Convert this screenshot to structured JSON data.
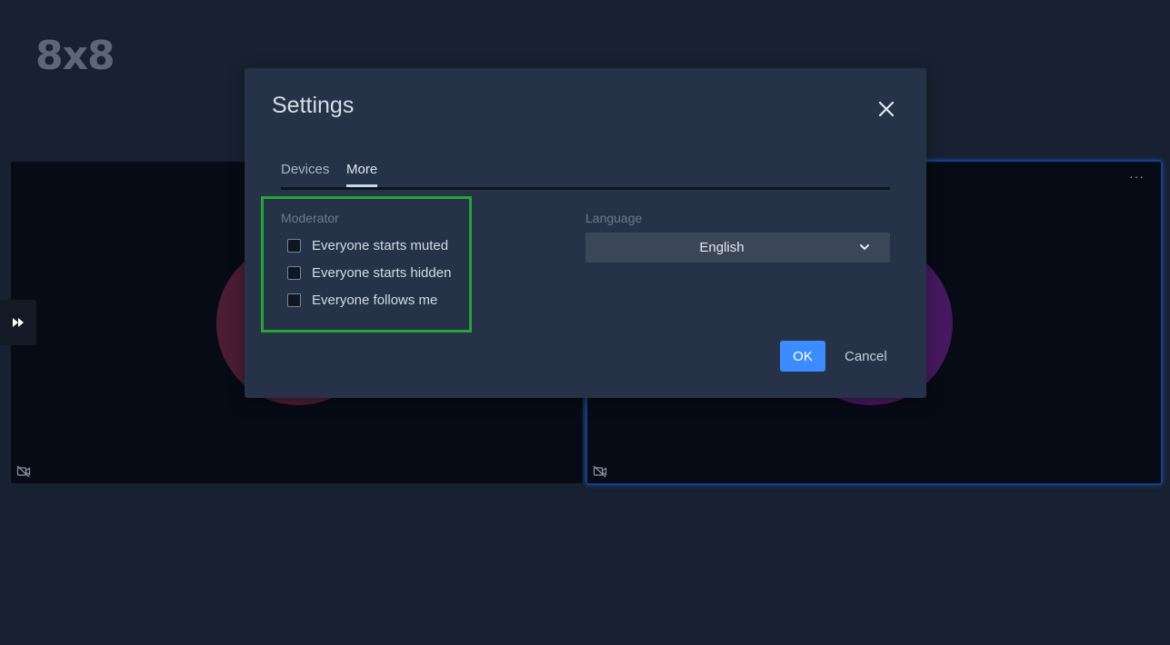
{
  "app": {
    "logo_text": "8x8"
  },
  "dialog": {
    "title": "Settings",
    "close_icon": "close-icon",
    "tabs": [
      {
        "label": "Devices",
        "active": false
      },
      {
        "label": "More",
        "active": true
      }
    ],
    "moderator": {
      "label": "Moderator",
      "options": [
        {
          "label": "Everyone starts muted",
          "checked": false
        },
        {
          "label": "Everyone starts hidden",
          "checked": false
        },
        {
          "label": "Everyone follows me",
          "checked": false
        }
      ]
    },
    "language": {
      "label": "Language",
      "selected": "English"
    },
    "ok_label": "OK",
    "cancel_label": "Cancel"
  },
  "tiles": {
    "menu_glyph": "···"
  },
  "colors": {
    "background": "#172131",
    "dialog": "#253248",
    "primary_button": "#3c8cff",
    "highlight_border": "#23a632",
    "active_speaker": "#13408a"
  }
}
